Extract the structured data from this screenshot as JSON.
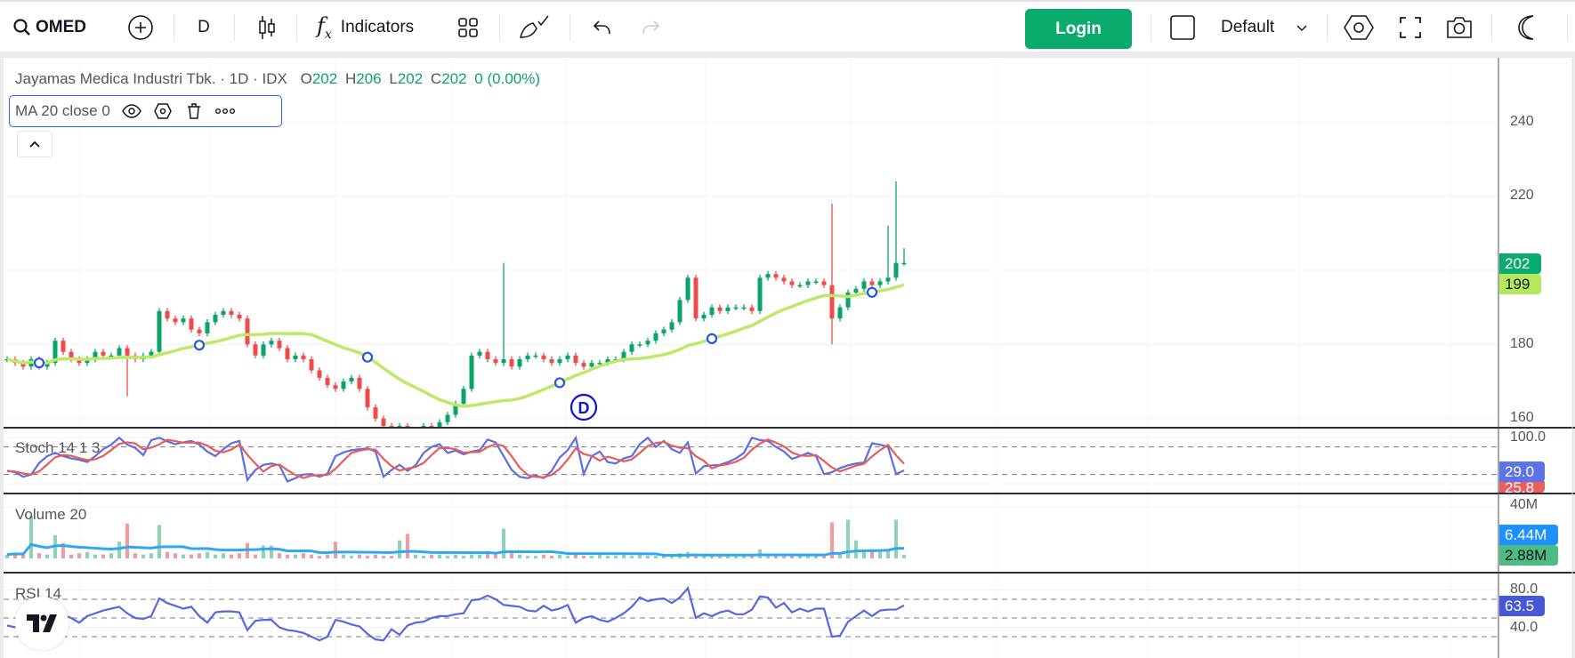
{
  "toolbar": {
    "symbol": "OMED",
    "interval": "D",
    "indicators_label": "Indicators",
    "login_label": "Login",
    "layout_label": "Default"
  },
  "legend": {
    "name": "Jayamas Medica Industri Tbk.",
    "dot": "·",
    "interval": "1D",
    "exchange": "IDX",
    "o_label": "O",
    "o": "202",
    "h_label": "H",
    "h": "206",
    "l_label": "L",
    "l": "202",
    "c_label": "C",
    "c": "202",
    "change": "0 (0.00%)"
  },
  "ma_legend": {
    "label": "MA 20 close 0"
  },
  "price_axis": {
    "ticks": [
      {
        "value": 240,
        "label": "240"
      },
      {
        "value": 220,
        "label": "220"
      },
      {
        "value": 180,
        "label": "180"
      },
      {
        "value": 160,
        "label": "160"
      }
    ],
    "last_price": "202",
    "ma_value": "199"
  },
  "stoch": {
    "title": "Stoch 14 1 3",
    "tick": "100.0",
    "k_value": "29.0",
    "d_value": "25.8"
  },
  "volume": {
    "title": "Volume 20",
    "tick": "40M",
    "ma_value": "6.44M",
    "value": "2.88M"
  },
  "rsi": {
    "title": "RSI 14",
    "tick_high": "80.0",
    "tick_low": "40.0",
    "value": "63.5"
  },
  "dividend_marker": {
    "label": "D"
  },
  "colors": {
    "up": "#0aa36a",
    "down": "#ee4b4b",
    "ma": "#bde86a",
    "login": "#0aab6c",
    "stoch_k": "#5a6fe3",
    "stoch_d": "#e95b5b",
    "rsi": "#5468e0",
    "vol_ma": "#2ea8f5",
    "last_badge": "#0aab6f",
    "ma_badge": "#b5e85c",
    "k_badge": "#5f73e8",
    "d_badge": "#ec5d5d",
    "volma_badge": "#1e90ff",
    "vol_badge": "#4dbb82",
    "rsi_badge": "#4658d8"
  },
  "chart_data": {
    "type": "candlestick",
    "ylim": [
      160,
      240
    ],
    "ma_period": 20,
    "closes": [
      176,
      175,
      174,
      176,
      174,
      175,
      181,
      178,
      176,
      175,
      176,
      178,
      177,
      177,
      179,
      177,
      176,
      177,
      178,
      189,
      187,
      186,
      187,
      184,
      183,
      186,
      188,
      189,
      188,
      187,
      180,
      177,
      180,
      181,
      179,
      176,
      177,
      176,
      173,
      171,
      169,
      168,
      170,
      171,
      168,
      163,
      160,
      158,
      157,
      158,
      156,
      157,
      158,
      157,
      159,
      161,
      164,
      168,
      177,
      178,
      176,
      175,
      176,
      174,
      176,
      177,
      177,
      176,
      175,
      176,
      177,
      175,
      174,
      175,
      175,
      176,
      176,
      178,
      180,
      180,
      181,
      183,
      184,
      186,
      192,
      198,
      187,
      188,
      190,
      189,
      190,
      190,
      190,
      189,
      198,
      199,
      198,
      197,
      196,
      196,
      197,
      197,
      196,
      187,
      190,
      194,
      195,
      197,
      196,
      197,
      198,
      202,
      202
    ],
    "spikes": [
      {
        "i": 62,
        "high": 202
      },
      {
        "i": 103,
        "high": 218,
        "low": 180
      },
      {
        "i": 111,
        "high": 224
      },
      {
        "i": 112,
        "high": 206
      },
      {
        "i": 15,
        "low": 166
      },
      {
        "i": 110,
        "high": 212
      }
    ],
    "last_ohlc": {
      "open": 202,
      "high": 206,
      "low": 202,
      "close": 202
    },
    "ma_markers": [
      4,
      24,
      45,
      69,
      88,
      108
    ],
    "dividend_index": 72,
    "stoch_k": [
      28,
      25,
      15,
      20,
      45,
      60,
      67,
      60,
      55,
      52,
      47,
      60,
      75,
      85,
      100,
      85,
      78,
      62,
      95,
      100,
      92,
      86,
      90,
      93,
      85,
      70,
      60,
      75,
      88,
      93,
      8,
      30,
      41,
      44,
      40,
      5,
      12,
      20,
      21,
      15,
      22,
      60,
      68,
      73,
      75,
      77,
      70,
      15,
      30,
      41,
      28,
      40,
      67,
      80,
      86,
      67,
      72,
      64,
      70,
      73,
      96,
      90,
      60,
      30,
      15,
      12,
      18,
      12,
      28,
      57,
      73,
      100,
      21,
      60,
      70,
      47,
      44,
      55,
      60,
      86,
      100,
      80,
      93,
      75,
      67,
      90,
      22,
      38,
      40,
      41,
      47,
      55,
      67,
      100,
      95,
      93,
      80,
      70,
      54,
      60,
      67,
      60,
      21,
      25,
      34,
      40,
      44,
      46,
      88,
      85,
      80,
      21,
      29
    ],
    "stoch_levels": [
      80,
      20
    ],
    "rsi": [
      42,
      40,
      45,
      52,
      50,
      54,
      55,
      53,
      50,
      45,
      52,
      55,
      58,
      60,
      62,
      55,
      50,
      49,
      52,
      71,
      66,
      63,
      60,
      62,
      52,
      45,
      56,
      57,
      57,
      56,
      37,
      47,
      48,
      48,
      40,
      37,
      36,
      34,
      30,
      26,
      30,
      48,
      46,
      43,
      41,
      33,
      27,
      26,
      38,
      32,
      42,
      45,
      46,
      50,
      52,
      52,
      54,
      55,
      69,
      70,
      74,
      70,
      64,
      63,
      62,
      58,
      57,
      63,
      58,
      60,
      64,
      45,
      50,
      52,
      48,
      46,
      50,
      55,
      62,
      72,
      68,
      70,
      71,
      66,
      72,
      82,
      50,
      55,
      52,
      56,
      58,
      54,
      54,
      59,
      73,
      72,
      61,
      66,
      56,
      60,
      57,
      60,
      60,
      30,
      31,
      46,
      52,
      58,
      52,
      58,
      59,
      59,
      63.5
    ],
    "rsi_levels": [
      70,
      50,
      30
    ],
    "volume_m": [
      3,
      4,
      3,
      33,
      4,
      3,
      18,
      12,
      3,
      4,
      5,
      3,
      3,
      4,
      13,
      27,
      4,
      3,
      4,
      26,
      5,
      4,
      3,
      3,
      4,
      5,
      3,
      4,
      3,
      4,
      12,
      3,
      10,
      10,
      4,
      3,
      3,
      4,
      3,
      2,
      3,
      13,
      3,
      2,
      3,
      2,
      3,
      2,
      2,
      14,
      19,
      3,
      2,
      3,
      3,
      2,
      3,
      2,
      3,
      3,
      4,
      3,
      23,
      4,
      3,
      2,
      2,
      3,
      2,
      3,
      2,
      3,
      2,
      2,
      3,
      2,
      2,
      3,
      2,
      3,
      2,
      2,
      3,
      2,
      4,
      5,
      3,
      2,
      2,
      3,
      2,
      2,
      2,
      3,
      7,
      2,
      2,
      2,
      2,
      2,
      2,
      2,
      2,
      28,
      3,
      30,
      14,
      5,
      6,
      5,
      7,
      30,
      2.88
    ]
  }
}
